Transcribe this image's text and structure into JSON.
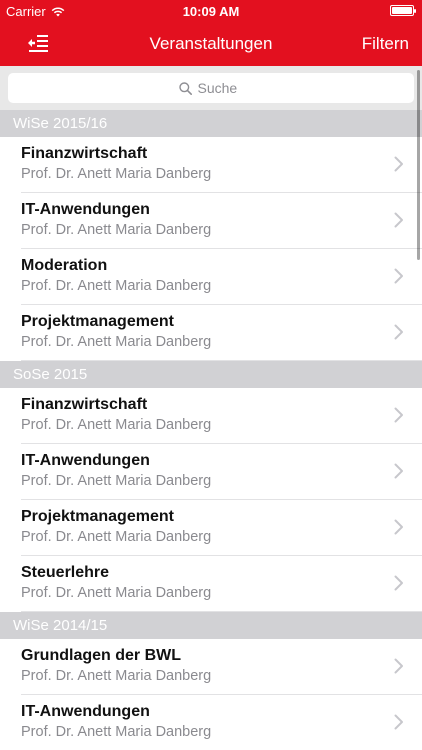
{
  "status": {
    "carrier": "Carrier",
    "time": "10:09 AM"
  },
  "navbar": {
    "title": "Veranstaltungen",
    "filter_label": "Filtern"
  },
  "search": {
    "placeholder": "Suche"
  },
  "sections": [
    {
      "title": "WiSe 2015/16",
      "items": [
        {
          "name": "Finanzwirtschaft",
          "professor": "Prof. Dr. Anett Maria Danberg"
        },
        {
          "name": "IT-Anwendungen",
          "professor": "Prof. Dr. Anett Maria Danberg"
        },
        {
          "name": "Moderation",
          "professor": "Prof. Dr. Anett Maria Danberg"
        },
        {
          "name": "Projektmanagement",
          "professor": "Prof. Dr. Anett Maria Danberg"
        }
      ]
    },
    {
      "title": "SoSe 2015",
      "items": [
        {
          "name": "Finanzwirtschaft",
          "professor": "Prof. Dr. Anett Maria Danberg"
        },
        {
          "name": "IT-Anwendungen",
          "professor": "Prof. Dr. Anett Maria Danberg"
        },
        {
          "name": "Projektmanagement",
          "professor": "Prof. Dr. Anett Maria Danberg"
        },
        {
          "name": "Steuerlehre",
          "professor": "Prof. Dr. Anett Maria Danberg"
        }
      ]
    },
    {
      "title": "WiSe 2014/15",
      "items": [
        {
          "name": "Grundlagen der BWL",
          "professor": "Prof. Dr. Anett Maria Danberg"
        },
        {
          "name": "IT-Anwendungen",
          "professor": "Prof. Dr. Anett Maria Danberg"
        }
      ]
    }
  ],
  "colors": {
    "accent": "#e3101f",
    "section_header": "#d1d1d4"
  },
  "icons": {
    "menu": "sort-list-icon",
    "search": "search-icon",
    "row_chevron": "chevron-right-icon"
  }
}
